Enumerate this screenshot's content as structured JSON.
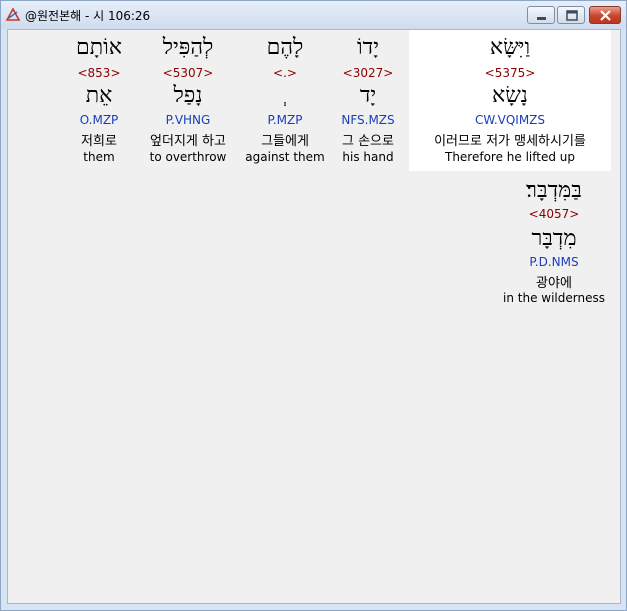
{
  "window": {
    "title": "@원전본해 - 시 106:26",
    "icons": {
      "app": "app-icon",
      "minimize": "minimize-icon",
      "maximize": "maximize-icon",
      "close": "close-icon"
    }
  },
  "words": [
    {
      "hebrew": "וַיִּשָּׂא",
      "strong": "<5375>",
      "lemma": "נָשָׂא",
      "morph": "CW.VQIMZS",
      "korean": "이러므로 저가 맹세하시기를",
      "english": "Therefore he lifted up"
    },
    {
      "hebrew": "יָדוֹ",
      "strong": "<3027>",
      "lemma": "יָד",
      "morph": "NFS.MZS",
      "korean": "그 손으로",
      "english": "his hand"
    },
    {
      "hebrew": "לָהֶם",
      "strong": "<.>",
      "lemma": "ְ",
      "morph": "P.MZP",
      "korean": "그들에게",
      "english": "against them"
    },
    {
      "hebrew": "לְהַפִּיל",
      "strong": "<5307>",
      "lemma": "נָפַל",
      "morph": "P.VHNG",
      "korean": "엎더지게 하고",
      "english": "to overthrow"
    },
    {
      "hebrew": "אוֹתָם",
      "strong": "<853>",
      "lemma": "אֵת",
      "morph": "O.MZP",
      "korean": "저희로",
      "english": "them"
    },
    {
      "hebrew": "בַּמִּדְבָּר׃",
      "strong": "<4057>",
      "lemma": "מִדְבָּר",
      "morph": "P.D.NMS",
      "korean": "광야에",
      "english": "in the wilderness"
    }
  ]
}
